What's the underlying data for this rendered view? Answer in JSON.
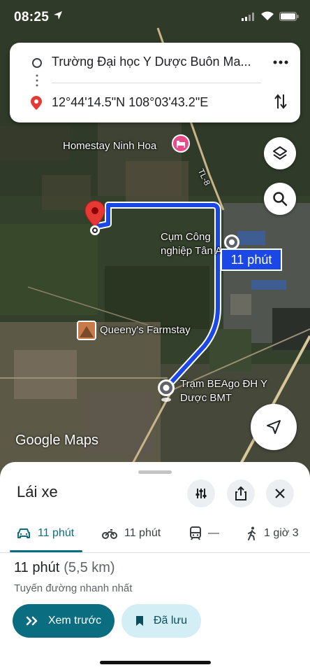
{
  "status_bar": {
    "time": "08:25"
  },
  "route_card": {
    "origin": "Trường Đại học Y Dược Buôn Ma...",
    "destination": "12°44'14.5\"N 108°03'43.2\"E"
  },
  "map": {
    "labels": {
      "homestay": "Homestay Ninh Hoa",
      "road": "TL-8",
      "cluster_line1": "Cụm Công",
      "cluster_line2": "nghiệp Tân An",
      "farmstay": "Queeny's Farmstay",
      "station_line1": "Trạm BEAgo ĐH Y",
      "station_line2": "Dược BMT"
    },
    "route_duration_badge": "11 phút",
    "watermark": "Google Maps",
    "route_color": "#1a47e6"
  },
  "sheet": {
    "title": "Lái xe",
    "modes": [
      {
        "icon": "car-icon",
        "label": "11 phút",
        "active": true
      },
      {
        "icon": "motorbike-icon",
        "label": "11 phút",
        "active": false
      },
      {
        "icon": "transit-icon",
        "label": "—",
        "active": false
      },
      {
        "icon": "walk-icon",
        "label": "1 giờ 3",
        "active": false
      }
    ],
    "summary_time": "11 phút",
    "summary_distance": "(5,5 km)",
    "route_note": "Tuyến đường nhanh nhất",
    "preview_label": "Xem trước",
    "saved_label": "Đã lưu"
  },
  "colors": {
    "accent": "#0b6e80",
    "saved_bg": "#d4eef6",
    "destination_pin": "#e53935"
  }
}
